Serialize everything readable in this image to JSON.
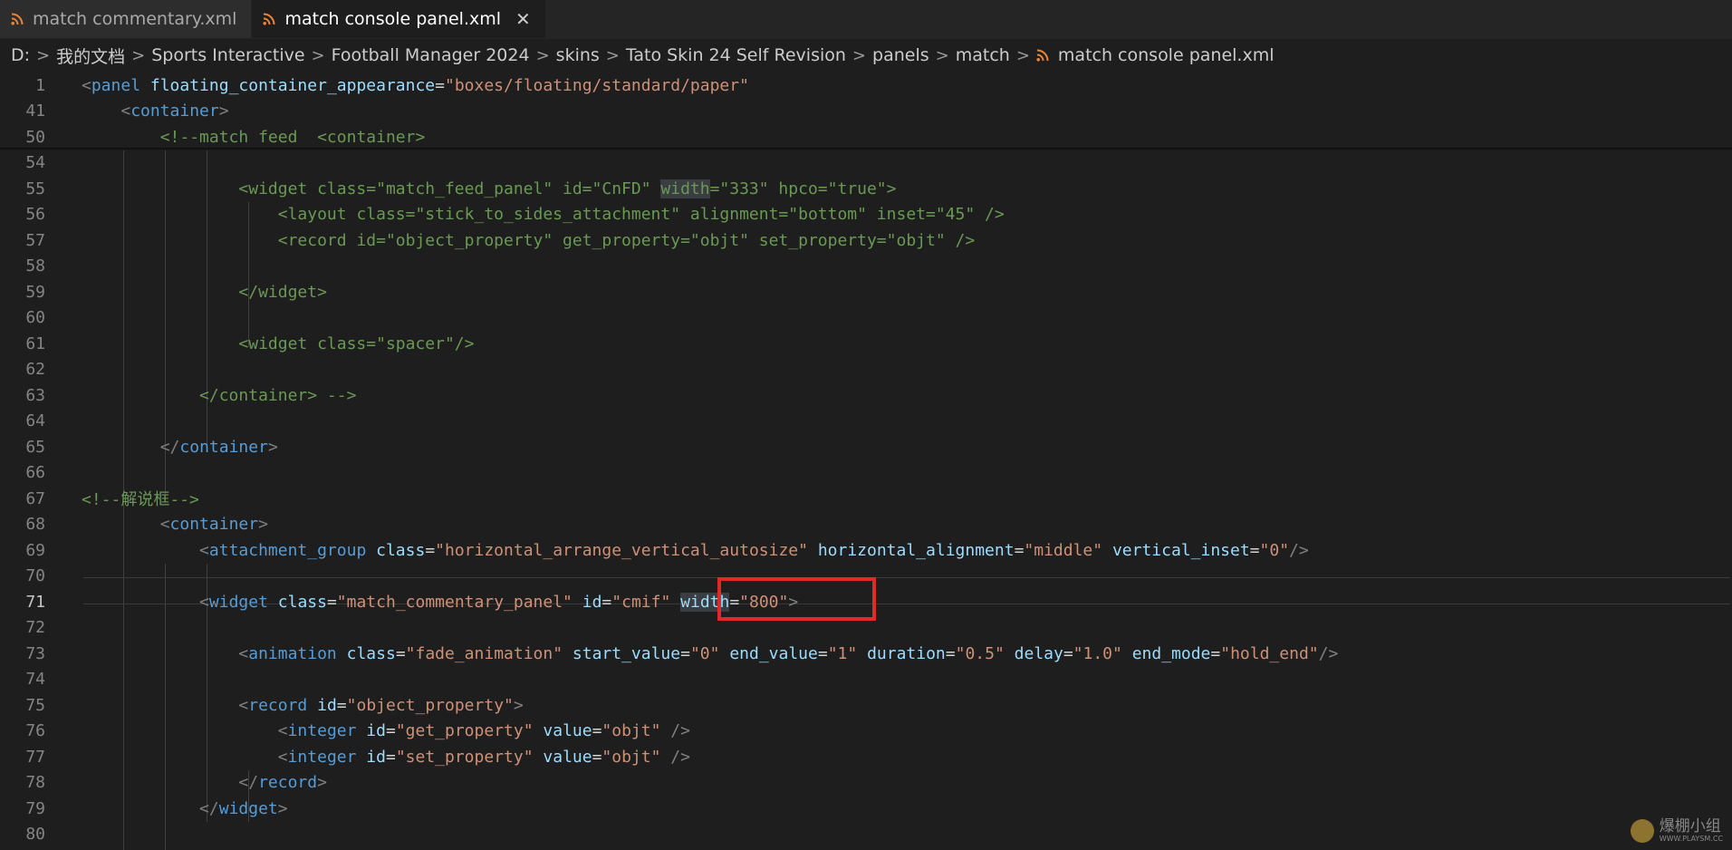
{
  "tabs": [
    {
      "label": "match commentary.xml",
      "active": false
    },
    {
      "label": "match console panel.xml",
      "active": true
    }
  ],
  "close_glyph": "✕",
  "breadcrumb": [
    "D:",
    "我的文档",
    "Sports Interactive",
    "Football Manager 2024",
    "skins",
    "Tato Skin 24 Self Revision",
    "panels",
    "match",
    "match console panel.xml"
  ],
  "breadcrumb_separator": ">",
  "file_icon": "rss-icon",
  "colors": {
    "file_icon": "#e8853b",
    "highlight_box": "#e02a2a"
  },
  "current_line": 71,
  "lines": [
    {
      "n": "1",
      "tokens": [
        [
          "p",
          "<"
        ],
        [
          "t",
          "panel"
        ],
        [
          "d",
          " "
        ],
        [
          "a",
          "floating_container_appearance"
        ],
        [
          "d",
          "="
        ],
        [
          "s",
          "\"boxes/floating/standard/paper\""
        ]
      ]
    },
    {
      "n": "41",
      "tokens": [
        [
          "d",
          "    "
        ],
        [
          "p",
          "<"
        ],
        [
          "t",
          "container"
        ],
        [
          "p",
          ">"
        ]
      ]
    },
    {
      "n": "50",
      "tokens": [
        [
          "d",
          "        "
        ],
        [
          "c",
          "<!--match feed  <container>"
        ]
      ]
    },
    {
      "n": "54",
      "tokens": []
    },
    {
      "n": "55",
      "tokens": [
        [
          "d",
          "                "
        ],
        [
          "c",
          "<widget class=\"match_feed_panel\" id=\"CnFD\" "
        ],
        [
          "c",
          "width",
          "hl"
        ],
        [
          "c",
          "=\"333\" hpco=\"true\">"
        ]
      ]
    },
    {
      "n": "56",
      "tokens": [
        [
          "d",
          "                    "
        ],
        [
          "c",
          "<layout class=\"stick_to_sides_attachment\" alignment=\"bottom\" inset=\"45\" />"
        ]
      ]
    },
    {
      "n": "57",
      "tokens": [
        [
          "d",
          "                    "
        ],
        [
          "c",
          "<record id=\"object_property\" get_property=\"objt\" set_property=\"objt\" />"
        ]
      ]
    },
    {
      "n": "58",
      "tokens": []
    },
    {
      "n": "59",
      "tokens": [
        [
          "d",
          "                "
        ],
        [
          "c",
          "</widget>"
        ]
      ]
    },
    {
      "n": "60",
      "tokens": []
    },
    {
      "n": "61",
      "tokens": [
        [
          "d",
          "                "
        ],
        [
          "c",
          "<widget class=\"spacer\"/>"
        ]
      ]
    },
    {
      "n": "62",
      "tokens": []
    },
    {
      "n": "63",
      "tokens": [
        [
          "d",
          "            "
        ],
        [
          "c",
          "</container> -->"
        ]
      ]
    },
    {
      "n": "64",
      "tokens": []
    },
    {
      "n": "65",
      "tokens": [
        [
          "d",
          "        "
        ],
        [
          "p",
          "</"
        ],
        [
          "t",
          "container"
        ],
        [
          "p",
          ">"
        ]
      ]
    },
    {
      "n": "66",
      "tokens": []
    },
    {
      "n": "67",
      "tokens": [
        [
          "c",
          "<!--解说框-->"
        ]
      ]
    },
    {
      "n": "68",
      "tokens": [
        [
          "d",
          "        "
        ],
        [
          "p",
          "<"
        ],
        [
          "t",
          "container"
        ],
        [
          "p",
          ">"
        ]
      ]
    },
    {
      "n": "69",
      "tokens": [
        [
          "d",
          "            "
        ],
        [
          "p",
          "<"
        ],
        [
          "t",
          "attachment_group"
        ],
        [
          "d",
          " "
        ],
        [
          "a",
          "class"
        ],
        [
          "d",
          "="
        ],
        [
          "s",
          "\"horizontal_arrange_vertical_autosize\""
        ],
        [
          "d",
          " "
        ],
        [
          "a",
          "horizontal_alignment"
        ],
        [
          "d",
          "="
        ],
        [
          "s",
          "\"middle\""
        ],
        [
          "d",
          " "
        ],
        [
          "a",
          "vertical_inset"
        ],
        [
          "d",
          "="
        ],
        [
          "s",
          "\"0\""
        ],
        [
          "p",
          "/>"
        ]
      ]
    },
    {
      "n": "70",
      "tokens": []
    },
    {
      "n": "71",
      "tokens": [
        [
          "d",
          "            "
        ],
        [
          "p",
          "<"
        ],
        [
          "t",
          "widget"
        ],
        [
          "d",
          " "
        ],
        [
          "a",
          "class"
        ],
        [
          "d",
          "="
        ],
        [
          "s",
          "\"match_commentary_panel\""
        ],
        [
          "d",
          " "
        ],
        [
          "a",
          "id"
        ],
        [
          "d",
          "="
        ],
        [
          "s",
          "\"cmif\""
        ],
        [
          "d",
          " "
        ],
        [
          "a",
          "width",
          "hl"
        ],
        [
          "d",
          "="
        ],
        [
          "s",
          "\"800\""
        ],
        [
          "p",
          ">"
        ]
      ]
    },
    {
      "n": "72",
      "tokens": []
    },
    {
      "n": "73",
      "tokens": [
        [
          "d",
          "                "
        ],
        [
          "p",
          "<"
        ],
        [
          "t",
          "animation"
        ],
        [
          "d",
          " "
        ],
        [
          "a",
          "class"
        ],
        [
          "d",
          "="
        ],
        [
          "s",
          "\"fade_animation\""
        ],
        [
          "d",
          " "
        ],
        [
          "a",
          "start_value"
        ],
        [
          "d",
          "="
        ],
        [
          "s",
          "\"0\""
        ],
        [
          "d",
          " "
        ],
        [
          "a",
          "end_value"
        ],
        [
          "d",
          "="
        ],
        [
          "s",
          "\"1\""
        ],
        [
          "d",
          " "
        ],
        [
          "a",
          "duration"
        ],
        [
          "d",
          "="
        ],
        [
          "s",
          "\"0.5\""
        ],
        [
          "d",
          " "
        ],
        [
          "a",
          "delay"
        ],
        [
          "d",
          "="
        ],
        [
          "s",
          "\"1.0\""
        ],
        [
          "d",
          " "
        ],
        [
          "a",
          "end_mode"
        ],
        [
          "d",
          "="
        ],
        [
          "s",
          "\"hold_end\""
        ],
        [
          "p",
          "/>"
        ]
      ]
    },
    {
      "n": "74",
      "tokens": []
    },
    {
      "n": "75",
      "tokens": [
        [
          "d",
          "                "
        ],
        [
          "p",
          "<"
        ],
        [
          "t",
          "record"
        ],
        [
          "d",
          " "
        ],
        [
          "a",
          "id"
        ],
        [
          "d",
          "="
        ],
        [
          "s",
          "\"object_property\""
        ],
        [
          "p",
          ">"
        ]
      ]
    },
    {
      "n": "76",
      "tokens": [
        [
          "d",
          "                    "
        ],
        [
          "p",
          "<"
        ],
        [
          "t",
          "integer"
        ],
        [
          "d",
          " "
        ],
        [
          "a",
          "id"
        ],
        [
          "d",
          "="
        ],
        [
          "s",
          "\"get_property\""
        ],
        [
          "d",
          " "
        ],
        [
          "a",
          "value"
        ],
        [
          "d",
          "="
        ],
        [
          "s",
          "\"objt\""
        ],
        [
          "d",
          " "
        ],
        [
          "p",
          "/>"
        ]
      ]
    },
    {
      "n": "77",
      "tokens": [
        [
          "d",
          "                    "
        ],
        [
          "p",
          "<"
        ],
        [
          "t",
          "integer"
        ],
        [
          "d",
          " "
        ],
        [
          "a",
          "id"
        ],
        [
          "d",
          "="
        ],
        [
          "s",
          "\"set_property\""
        ],
        [
          "d",
          " "
        ],
        [
          "a",
          "value"
        ],
        [
          "d",
          "="
        ],
        [
          "s",
          "\"objt\""
        ],
        [
          "d",
          " "
        ],
        [
          "p",
          "/>"
        ]
      ]
    },
    {
      "n": "78",
      "tokens": [
        [
          "d",
          "                "
        ],
        [
          "p",
          "</"
        ],
        [
          "t",
          "record"
        ],
        [
          "p",
          ">"
        ]
      ]
    },
    {
      "n": "79",
      "tokens": [
        [
          "d",
          "            "
        ],
        [
          "p",
          "</"
        ],
        [
          "t",
          "widget"
        ],
        [
          "p",
          ">"
        ]
      ]
    },
    {
      "n": "80",
      "tokens": []
    }
  ],
  "watermark": {
    "text": "爆棚小组",
    "sub": "WWW.PLAYSM.CC"
  }
}
